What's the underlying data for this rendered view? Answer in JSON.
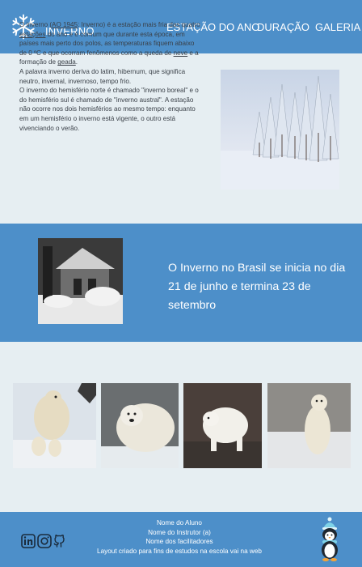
{
  "header": {
    "brand": "INVERNO",
    "nav": [
      "ESTAÇÃO DO ANO",
      "DURAÇÃO",
      "GALERIA"
    ],
    "logo_icon": "snowflake-icon"
  },
  "intro": {
    "p1_a": "O inverno (",
    "p1_link1": "AO 1945",
    "p1_b": ": Inverno) é a estação mais fria das quatro ",
    "p1_link2": "estações",
    "p1_c": " do ano e é comum que durante esta época, em países mais perto dos polos, as temperaturas fiquem abaixo de 0 ºC e que ocorram fenômenos como a queda de ",
    "p1_link3": "neve",
    "p1_d": " e a formação de ",
    "p1_link4": "geada",
    "p1_e": ".",
    "p2": "A palavra inverno deriva do latim, hibernum, que significa neutro, invernal, invernoso, tempo frio.",
    "p3": "O inverno do hemisfério norte é chamado \"inverno boreal\" e o do hemisfério sul é chamado de \"inverno austral\". A estação não ocorre nos dois hemisférios ao mesmo tempo: enquanto em um hemisfério o inverno está vigente, o outro está vivenciando o verão."
  },
  "band": {
    "text": "O Inverno no Brasil  se inicia no dia 21 de junho e termina 23 de setembro"
  },
  "footer": {
    "lines": [
      "Nome do Aluno",
      "Nome do Instrutor (a)",
      "Nome dos facilitadores",
      "Layout criado para fins de estudos na escola vai na web"
    ],
    "social_icons": [
      "linkedin-icon",
      "instagram-icon",
      "github-icon"
    ],
    "mascot": "penguin-icon"
  },
  "colors": {
    "primary": "#4d8fc9",
    "background": "#e6eef2",
    "text": "#3a4048"
  }
}
